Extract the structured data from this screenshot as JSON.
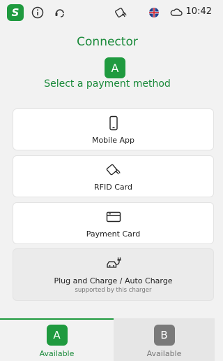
{
  "status_bar": {
    "brand_glyph": "S",
    "time": "10:42",
    "icons": [
      "info-icon",
      "support-headset-icon",
      "rfid-tap-icon",
      "uk-flag-icon",
      "cloud-icon"
    ]
  },
  "header": {
    "title": "Connector",
    "connector": "A",
    "subtitle": "Select a payment method"
  },
  "payment_methods": [
    {
      "label": "Mobile App",
      "icon": "smartphone-icon"
    },
    {
      "label": "RFID Card",
      "icon": "rfid-card-icon"
    },
    {
      "label": "Payment Card",
      "icon": "credit-card-icon"
    },
    {
      "label": "Plug and Charge / Auto Charge",
      "sublabel": "supported by this charger",
      "icon": "ev-plug-car-icon"
    }
  ],
  "connector_tabs": [
    {
      "letter": "A",
      "status": "Available",
      "selected": true
    },
    {
      "letter": "B",
      "status": "Available",
      "selected": false
    }
  ],
  "colors": {
    "accent": "#1f9a3f",
    "inactive": "#7a7a7a",
    "background": "#f2f2f2"
  }
}
